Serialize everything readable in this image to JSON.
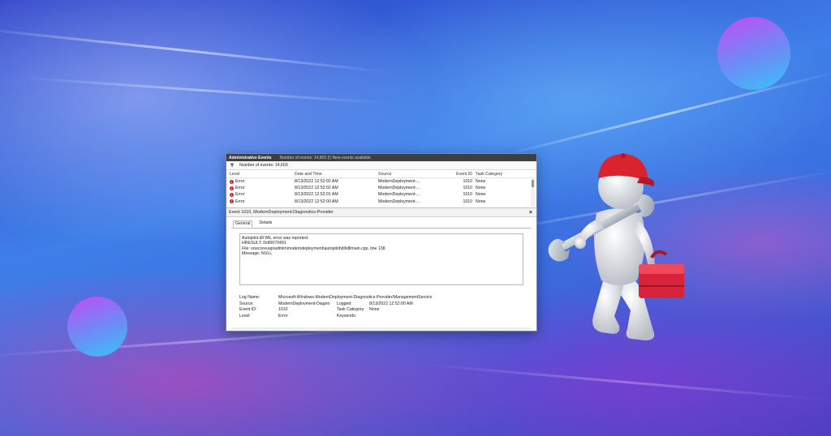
{
  "window": {
    "title": "Administrative Events",
    "title_info": "Number of events: 14,603 (!) New events available",
    "filter_text": "Number of events: 14,603"
  },
  "table": {
    "columns": [
      "Level",
      "Date and Time",
      "Source",
      "Event ID",
      "Task Category"
    ],
    "rows": [
      {
        "level": "Error",
        "date": "8/13/2022 12:52:02 AM",
        "source": "ModernDeployment-...",
        "id": "1010",
        "category": "None"
      },
      {
        "level": "Error",
        "date": "8/13/2022 12:52:02 AM",
        "source": "ModernDeployment-...",
        "id": "1010",
        "category": "None"
      },
      {
        "level": "Error",
        "date": "8/13/2022 12:52:01 AM",
        "source": "ModernDeployment-...",
        "id": "1010",
        "category": "None"
      },
      {
        "level": "Error",
        "date": "8/13/2022 12:52:00 AM",
        "source": "ModernDeployment-...",
        "id": "1010",
        "category": "None"
      }
    ]
  },
  "detail": {
    "header": "Event 1010, ModernDeployment-Diagnostics-Provider",
    "close": "×",
    "tabs": [
      "General",
      "Details"
    ],
    "message": [
      "Autopilot.dll WiL error was reported.",
      "HRESULT: 0x80070491",
      "File: onecoreuap\\admin\\moderndeployment\\autopilot\\dll\\dllmain.cpp, line 138",
      "Message: NULL"
    ],
    "props": {
      "log_name_label": "Log Name:",
      "log_name_value": "Microsoft-Windows-ModernDeployment-Diagnostics-Provider/ManagementService",
      "source_label": "Source:",
      "source_value": "ModernDeployment-Diagno",
      "logged_label": "Logged:",
      "logged_value": "8/13/2022 12:52:00 AM",
      "event_id_label": "Event ID:",
      "event_id_value": "1010",
      "task_category_label": "Task Category:",
      "task_category_value": "None",
      "level_label": "Level:",
      "level_value": "Error",
      "keywords_label": "Keywords:",
      "keywords_value": ""
    }
  },
  "colors": {
    "error": "#c4262e",
    "cap_red": "#d9242f",
    "toolbox_red": "#d8243a"
  },
  "icons": [
    "filter-icon",
    "error-icon",
    "close-icon",
    "wrench-icon",
    "toolbox-icon"
  ]
}
